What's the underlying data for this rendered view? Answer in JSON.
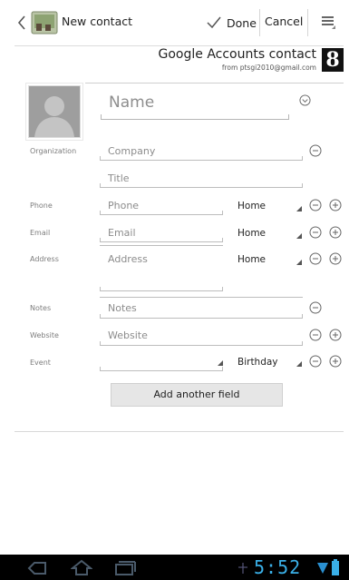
{
  "action_bar": {
    "title": "New contact",
    "done_label": "Done",
    "cancel_label": "Cancel",
    "back_icon": "chevron-left-icon",
    "app_icon": "contacts-app-icon",
    "menu_icon": "overflow-menu-icon"
  },
  "account": {
    "name": "Google Accounts contact",
    "from": "from ptsgi2010@gmail.com",
    "logo_letter": "8"
  },
  "name_field": {
    "placeholder": "Name"
  },
  "rows": {
    "organization": {
      "label": "Organization",
      "company": "Company",
      "title": "Title"
    },
    "phone": {
      "label": "Phone",
      "placeholder": "Phone",
      "type": "Home"
    },
    "email": {
      "label": "Email",
      "placeholder": "Email",
      "type": "Home"
    },
    "address": {
      "label": "Address",
      "placeholder": "Address",
      "type": "Home"
    },
    "notes": {
      "label": "Notes",
      "placeholder": "Notes"
    },
    "website": {
      "label": "Website",
      "placeholder": "Website"
    },
    "event": {
      "label": "Event",
      "type": "Birthday"
    }
  },
  "add_field_label": "Add another field",
  "status_bar": {
    "time": "5:52"
  },
  "colors": {
    "accent": "#3ab0e8",
    "status_bg": "#000000"
  }
}
